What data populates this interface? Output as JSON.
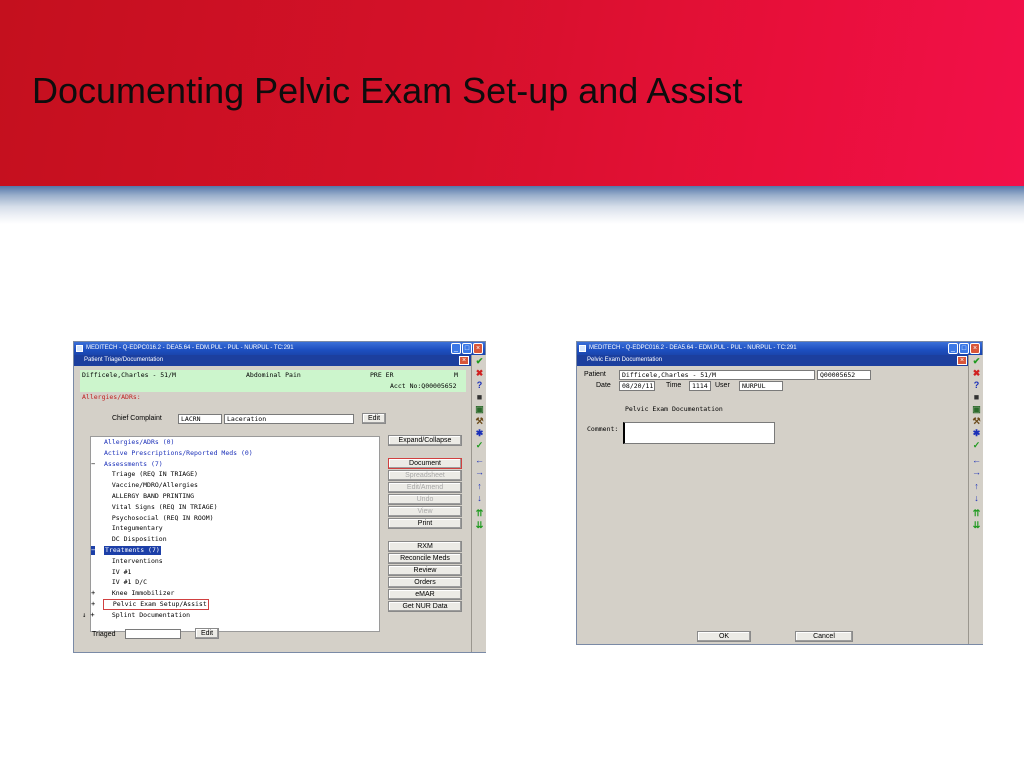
{
  "slide": {
    "title": "Documenting Pelvic Exam Set-up and Assist"
  },
  "left_window": {
    "titlebar": "MEDITECH - Q-EDPC016.2 - DEA5.64 - EDM.PUL - PUL - NURPUL - TC:291",
    "subtitle": "Patient Triage/Documentation",
    "patient": {
      "name": "Difficele,Charles - 51/M",
      "complaint_summary": "Abdominal Pain",
      "location": "PRE ER",
      "status": "M",
      "acct": "Acct No:Q00005652",
      "allergies_label": "Allergies/ADRs:"
    },
    "chief_complaint": {
      "label": "Chief Complaint",
      "code": "LACRN",
      "text": "Laceration",
      "edit_label": "Edit"
    },
    "list_items": [
      {
        "text": "Allergies/ADRs (0)",
        "style": "blue",
        "marker": ""
      },
      {
        "text": "Active Prescriptions/Reported Meds (0)",
        "style": "blue",
        "marker": ""
      },
      {
        "text": "Assessments (7)",
        "style": "blue",
        "marker": "−"
      },
      {
        "text": "  Triage        (REQ IN TRIAGE)",
        "style": "",
        "marker": ""
      },
      {
        "text": "  Vaccine/MDRO/Allergies",
        "style": "",
        "marker": ""
      },
      {
        "text": "  ALLERGY BAND PRINTING",
        "style": "",
        "marker": ""
      },
      {
        "text": "  Vital Signs   (REQ IN TRIAGE)",
        "style": "",
        "marker": ""
      },
      {
        "text": "  Psychosocial  (REQ IN ROOM)",
        "style": "",
        "marker": ""
      },
      {
        "text": "  Integumentary",
        "style": "",
        "marker": ""
      },
      {
        "text": "  DC Disposition",
        "style": "",
        "marker": ""
      },
      {
        "text": "Treatments (7)",
        "style": "selected",
        "marker": "−"
      },
      {
        "text": "  Interventions",
        "style": "",
        "marker": ""
      },
      {
        "text": "  IV #1",
        "style": "",
        "marker": ""
      },
      {
        "text": "  IV #1 D/C",
        "style": "",
        "marker": ""
      },
      {
        "text": "  Knee Immobilizer",
        "style": "",
        "marker": "+"
      },
      {
        "text": "  Pelvic Exam Setup/Assist",
        "style": "boxed",
        "marker": "+"
      },
      {
        "text": "  Splint Documentation",
        "style": "",
        "marker": "↓ +"
      }
    ],
    "side_buttons": [
      {
        "label": "Expand/Collapse",
        "state": "normal"
      },
      {
        "label": "Document",
        "state": "active"
      },
      {
        "label": "Spreadsheet",
        "state": "disabled"
      },
      {
        "label": "Edit/Amend",
        "state": "disabled"
      },
      {
        "label": "Undo",
        "state": "disabled"
      },
      {
        "label": "View",
        "state": "disabled"
      },
      {
        "label": "Print",
        "state": "normal"
      },
      {
        "label": "RXM",
        "state": "normal"
      },
      {
        "label": "Reconcile Meds",
        "state": "normal"
      },
      {
        "label": "Review",
        "state": "normal"
      },
      {
        "label": "Orders",
        "state": "normal"
      },
      {
        "label": "eMAR",
        "state": "normal"
      },
      {
        "label": "Get NUR Data",
        "state": "normal"
      }
    ],
    "triaged": {
      "label": "Triaged",
      "value": "",
      "edit_label": "Edit"
    }
  },
  "right_window": {
    "titlebar": "MEDITECH - Q-EDPC016.2 - DEA5.64 - EDM.PUL - PUL - NURPUL - TC:291",
    "subtitle": "Pelvic Exam Documentation",
    "patient": {
      "patient_label": "Patient",
      "name": "Difficele,Charles  - 51/M",
      "acct": "Q00005652",
      "date_label": "Date",
      "date": "08/20/11",
      "time_label": "Time",
      "time": "1114",
      "user_label": "User",
      "user": "NURPUL"
    },
    "form_title": "Pelvic Exam Documentation",
    "comment_label": "Comment:",
    "comment_value": "",
    "ok_label": "OK",
    "cancel_label": "Cancel"
  },
  "toolbar_icons": [
    {
      "name": "check-icon",
      "glyph": "✔",
      "color": "#1f9a1f"
    },
    {
      "name": "x-icon",
      "glyph": "✖",
      "color": "#d02020"
    },
    {
      "name": "help-icon",
      "glyph": "?",
      "color": "#1a2fb8"
    },
    {
      "name": "binoculars-icon",
      "glyph": "■",
      "color": "#333333"
    },
    {
      "name": "report-icon",
      "glyph": "▣",
      "color": "#2a6a2a"
    },
    {
      "name": "tools-icon",
      "glyph": "⚒",
      "color": "#6a4a1a"
    },
    {
      "name": "asterisk-icon",
      "glyph": "✱",
      "color": "#1a2fb8"
    },
    {
      "name": "check-list-icon",
      "glyph": "✓",
      "color": "#1f9a1f"
    },
    {
      "name": "arrow-left-icon",
      "glyph": "←",
      "color": "#1a2fb8"
    },
    {
      "name": "arrow-right-icon",
      "glyph": "→",
      "color": "#1a2fb8"
    },
    {
      "name": "arrow-up-icon",
      "glyph": "↑",
      "color": "#1a2fb8"
    },
    {
      "name": "arrow-down-icon",
      "glyph": "↓",
      "color": "#1a2fb8"
    },
    {
      "name": "double-up-icon",
      "glyph": "⇈",
      "color": "#1f9a1f"
    },
    {
      "name": "double-down-icon",
      "glyph": "⇊",
      "color": "#1f9a1f"
    }
  ],
  "colors": {
    "banner_red": "#d5112a",
    "window_blue": "#1d4fc0",
    "patient_header_green": "#ccf5cc",
    "list_blue": "#1a2fb8"
  }
}
